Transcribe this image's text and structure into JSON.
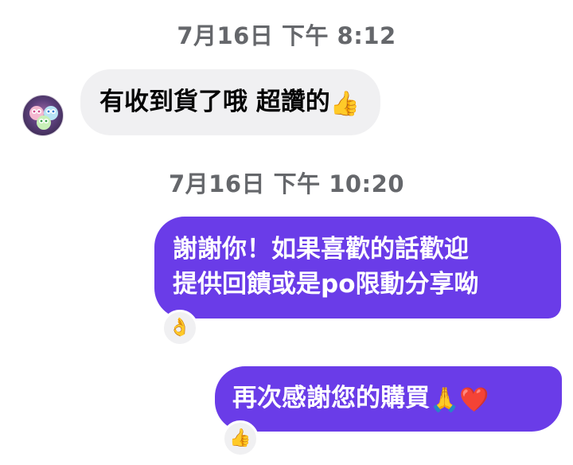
{
  "messages": [
    {
      "type": "timestamp",
      "text": "7月16日 下午 8:12"
    },
    {
      "type": "incoming",
      "text": "有收到貨了哦 超讚的",
      "emoji": "👍"
    },
    {
      "type": "timestamp",
      "text": "7月16日 下午 10:20"
    },
    {
      "type": "outgoing",
      "lines": [
        "謝謝你！如果喜歡的話歡迎",
        "提供回饋或是po限動分享呦"
      ],
      "reaction": "👌"
    },
    {
      "type": "outgoing",
      "text": "再次感謝您的購買",
      "emojis": [
        "🙏",
        "❤️"
      ],
      "reaction": "👍"
    }
  ],
  "colors": {
    "outgoing_bubble": "#6a3ce8",
    "incoming_bubble": "#f0f0f2",
    "timestamp_text": "#65676b"
  },
  "icons": {
    "avatar": "contact-avatar-image"
  }
}
